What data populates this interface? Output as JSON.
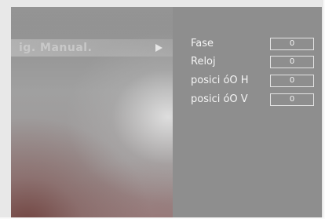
{
  "menu": {
    "selected_item_label": "ig. Manual."
  },
  "settings": {
    "rows": [
      {
        "label": "Fase",
        "value": "0"
      },
      {
        "label": "Reloj",
        "value": "0"
      },
      {
        "label": "posici óO H",
        "value": "0"
      },
      {
        "label": "posici óO V",
        "value": "0"
      }
    ]
  }
}
